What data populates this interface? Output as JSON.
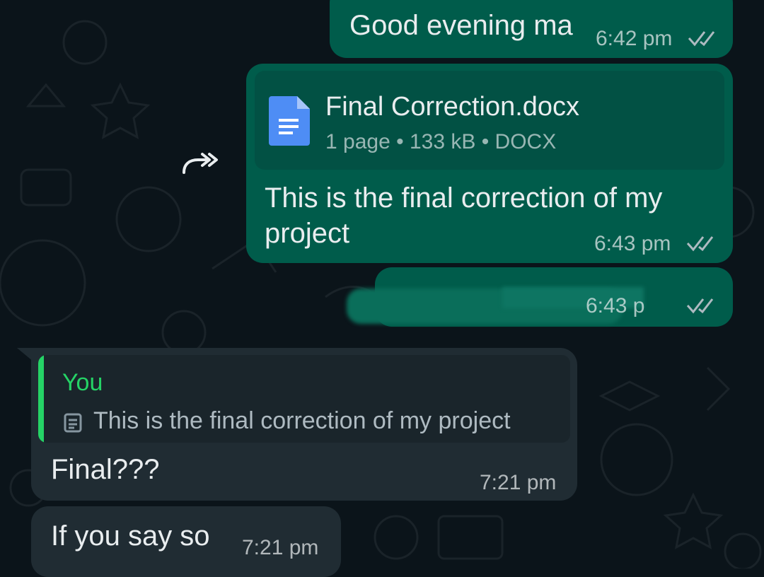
{
  "messages": {
    "m1": {
      "text": "Good evening ma",
      "time": "6:42 pm"
    },
    "m2": {
      "file_name": "Final Correction.docx",
      "file_pages": "1 page",
      "file_size": "133 kB",
      "file_type": "DOCX",
      "caption_line1": "This is the final correction of my",
      "caption_line2": "project",
      "time": "6:43 pm"
    },
    "m3": {
      "time": "6:43 p"
    },
    "m4": {
      "quote_author": "You",
      "quote_text": "This is the final correction of my project",
      "text": "Final???",
      "time": "7:21 pm"
    },
    "m5": {
      "text": "If you say so",
      "time": "7:21 pm"
    }
  },
  "colors": {
    "outgoing": "#005c4b",
    "incoming": "#202c33",
    "quote_accent": "#25d366",
    "read_ticks": "#aebac1"
  }
}
